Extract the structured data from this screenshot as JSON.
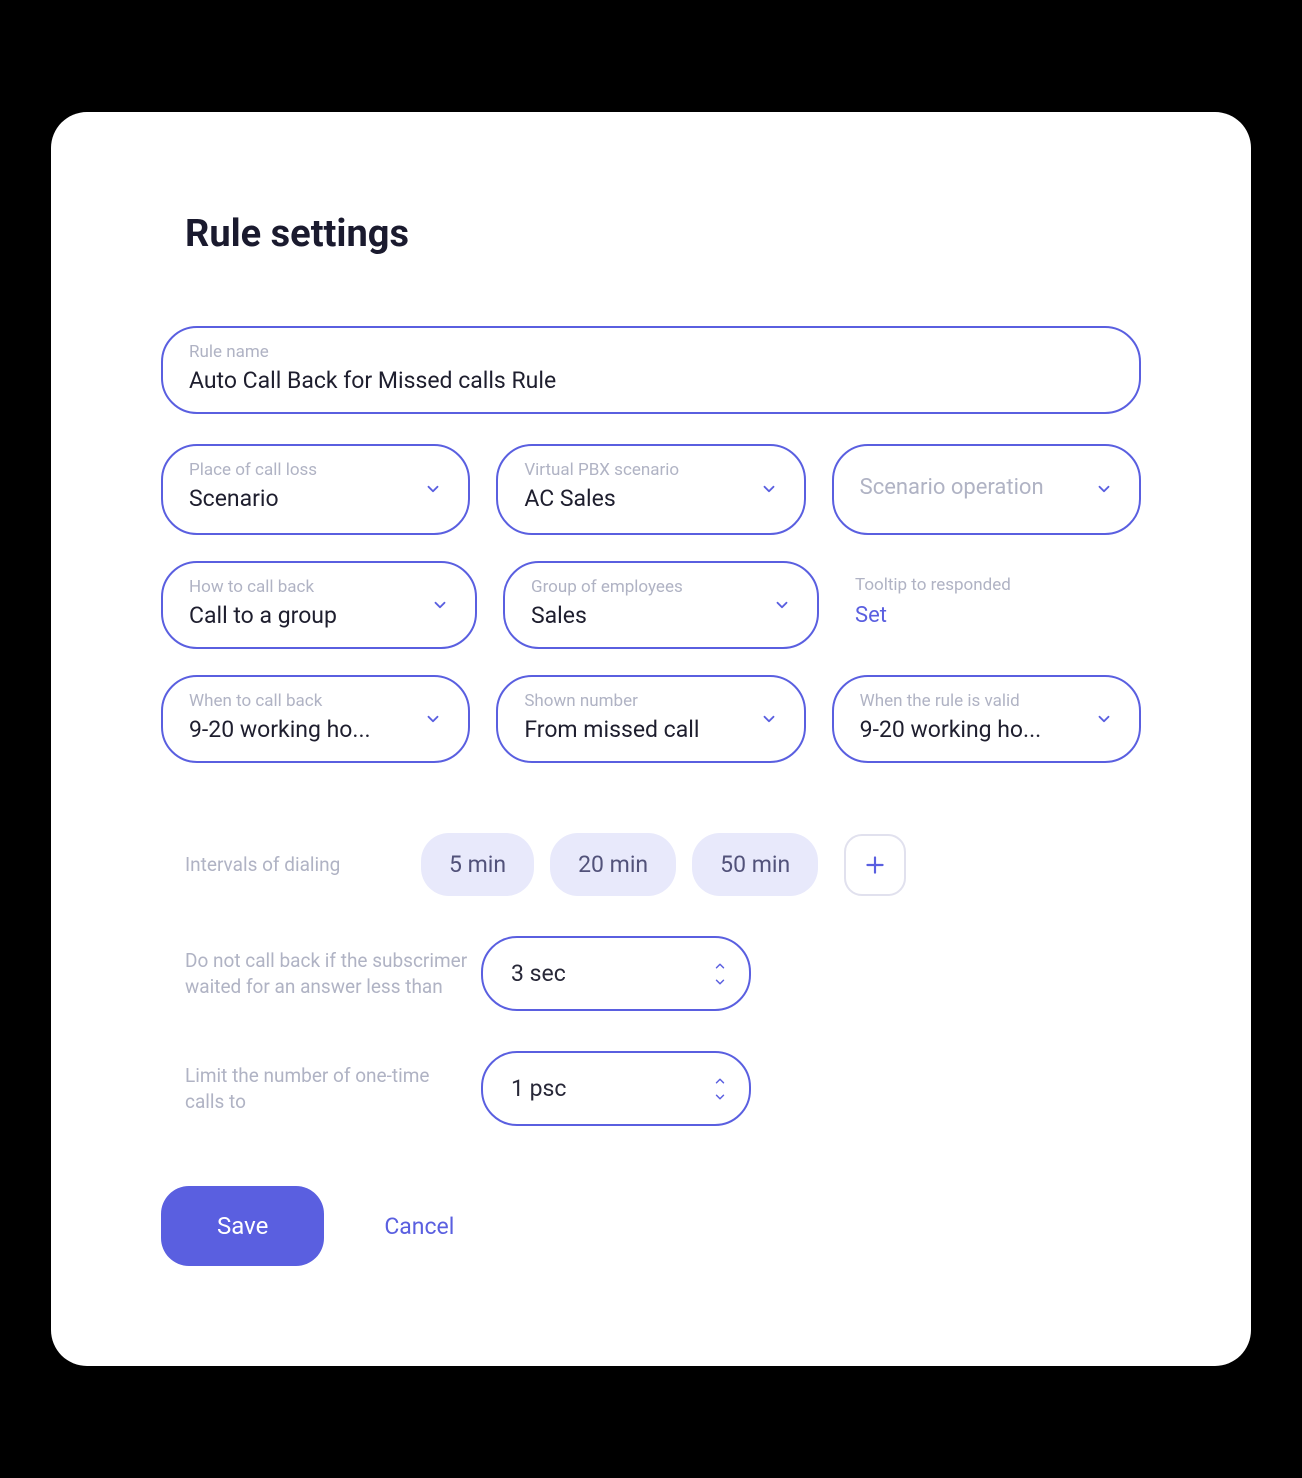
{
  "title": "Rule settings",
  "rule_name": {
    "label": "Rule name",
    "value": "Auto Call Back for Missed calls Rule"
  },
  "place_of_call_loss": {
    "label": "Place of call loss",
    "value": "Scenario"
  },
  "virtual_pbx_scenario": {
    "label": "Virtual PBX scenario",
    "value": "AC Sales"
  },
  "scenario_operation": {
    "placeholder": "Scenario operation"
  },
  "how_to_call_back": {
    "label": "How to call back",
    "value": "Call to a group"
  },
  "group_of_employees": {
    "label": "Group of employees",
    "value": "Sales"
  },
  "tooltip_to_responded": {
    "label": "Tooltip to responded",
    "link": "Set"
  },
  "when_to_call_back": {
    "label": "When to call back",
    "value": "9-20 working ho..."
  },
  "shown_number": {
    "label": "Shown number",
    "value": "From missed call"
  },
  "when_rule_valid": {
    "label": "When the rule is valid",
    "value": "9-20 working ho..."
  },
  "intervals": {
    "label": "Intervals of dialing",
    "chips": [
      "5 min",
      "20 min",
      "50 min"
    ]
  },
  "wait_threshold": {
    "label": "Do not call back if the subscrimer waited for an answer less than",
    "value": "3 sec"
  },
  "limit_calls": {
    "label": "Limit the number of one-time calls to",
    "value": "1 psc"
  },
  "footer": {
    "save": "Save",
    "cancel": "Cancel"
  }
}
